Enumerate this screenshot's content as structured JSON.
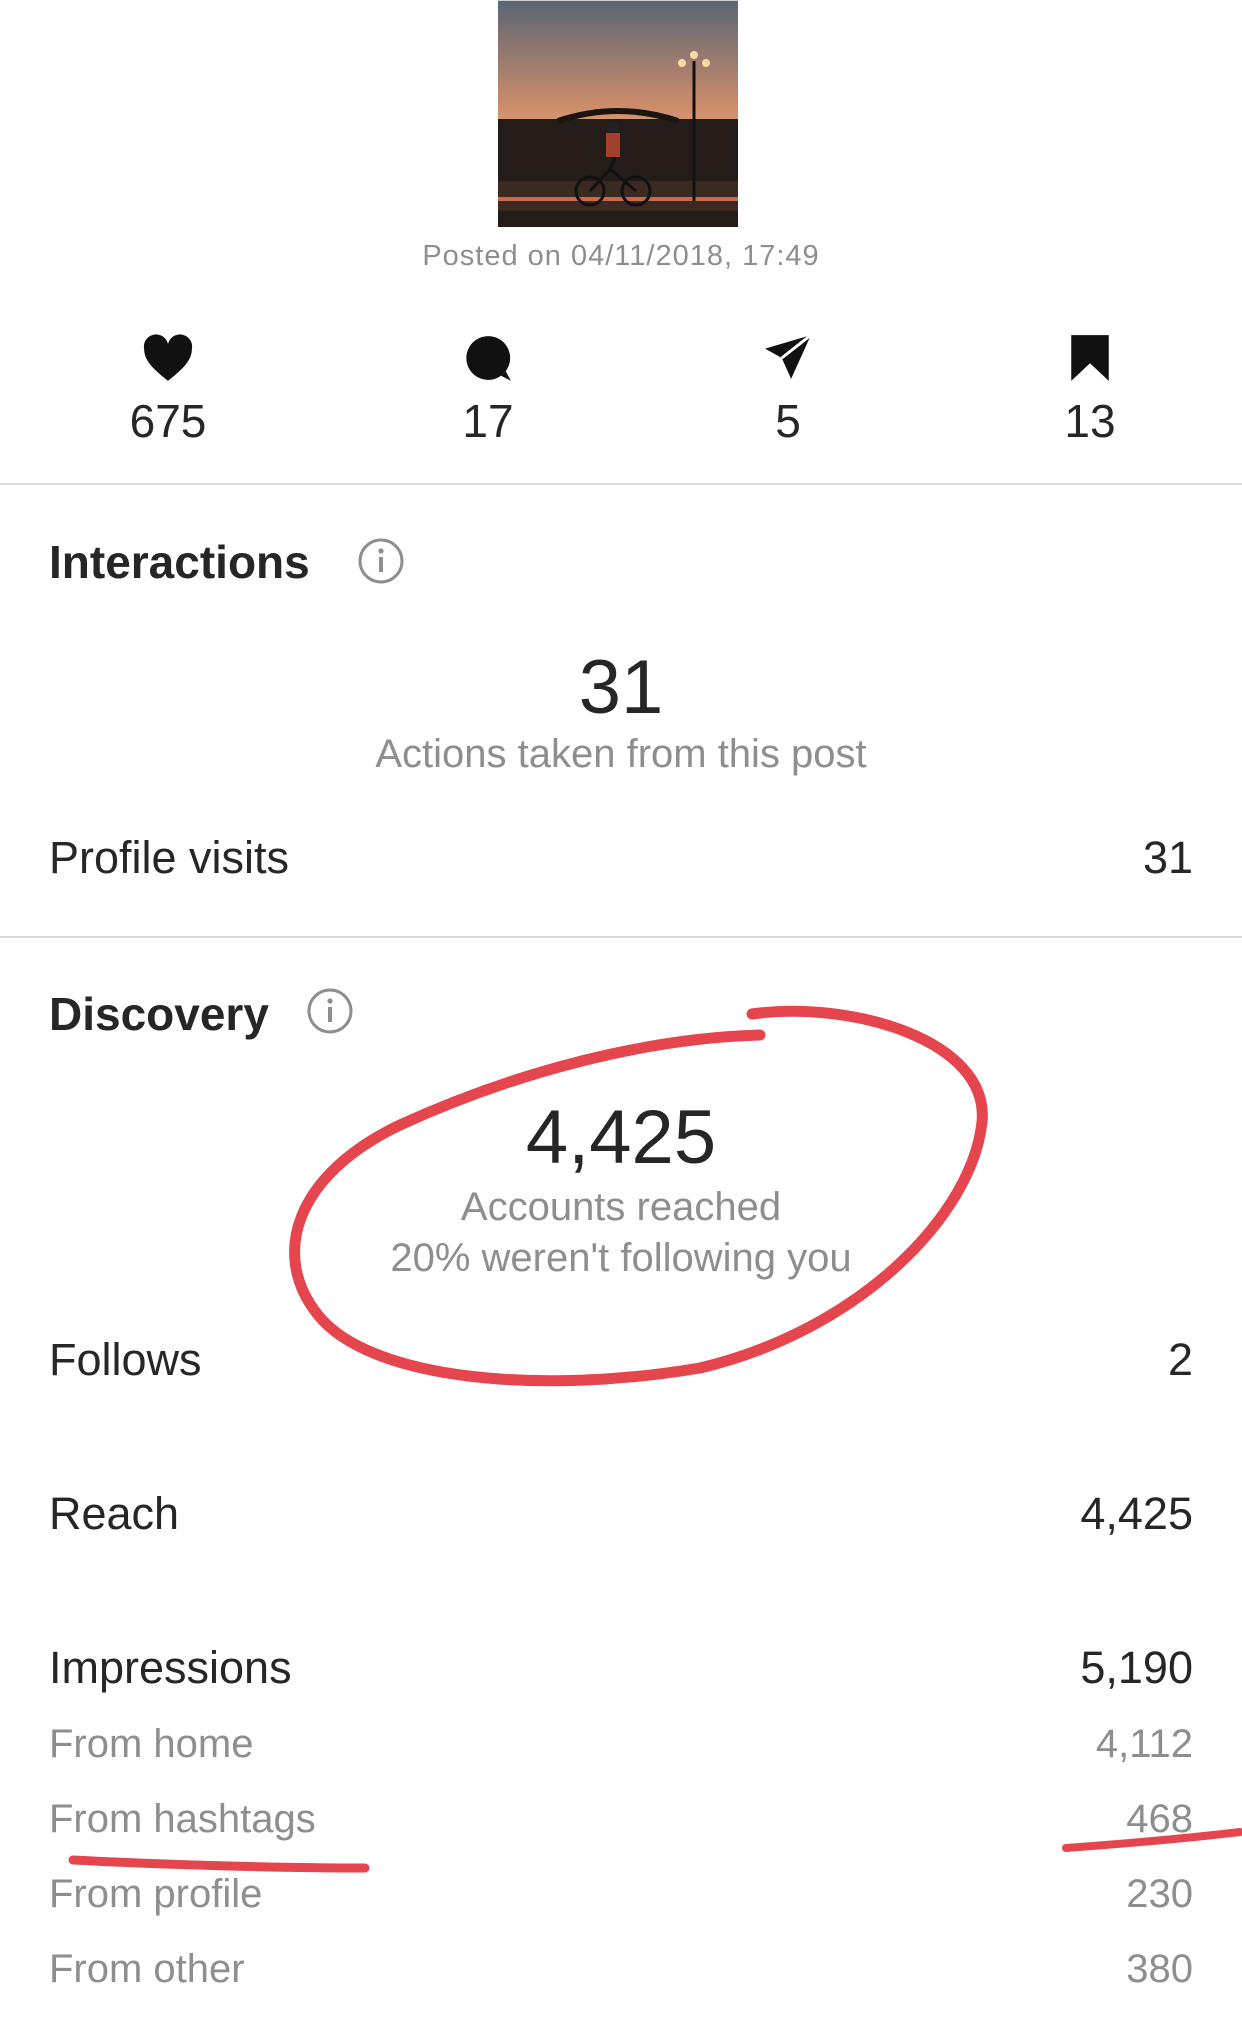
{
  "post": {
    "posted_label": "Posted on 04/11/2018, 17:49"
  },
  "stats": [
    {
      "icon": "heart-icon",
      "value": "675"
    },
    {
      "icon": "comment-icon",
      "value": "17"
    },
    {
      "icon": "share-icon",
      "value": "5"
    },
    {
      "icon": "bookmark-icon",
      "value": "13"
    }
  ],
  "interactions": {
    "title": "Interactions",
    "total": "31",
    "total_caption": "Actions taken from this post",
    "profile_visits_label": "Profile visits",
    "profile_visits_value": "31"
  },
  "discovery": {
    "title": "Discovery",
    "total": "4,425",
    "caption_line1": "Accounts reached",
    "caption_line2": "20% weren't following you",
    "rows": [
      {
        "label": "Follows",
        "value": "2"
      },
      {
        "label": "Reach",
        "value": "4,425"
      },
      {
        "label": "Impressions",
        "value": "5,190"
      }
    ],
    "impression_sources": [
      {
        "label": "From home",
        "value": "4,112"
      },
      {
        "label": "From hashtags",
        "value": "468"
      },
      {
        "label": "From profile",
        "value": "230"
      },
      {
        "label": "From other",
        "value": "380"
      }
    ]
  },
  "colors": {
    "text": "#262626",
    "secondary": "#8e8e8e",
    "divider": "#dbdbdb",
    "annotation": "#e5464e"
  }
}
